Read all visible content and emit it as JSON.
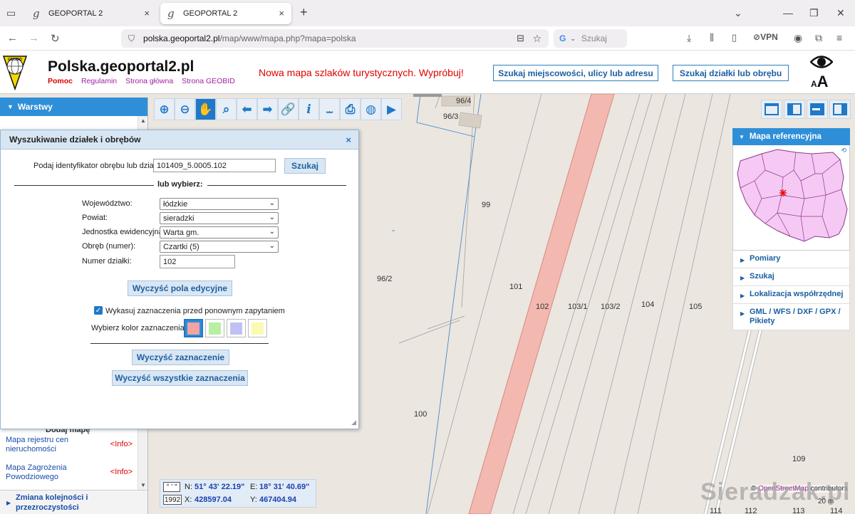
{
  "browser": {
    "tabs": [
      {
        "icon": "g",
        "title": "GEOPORTAL 2",
        "close": "×"
      },
      {
        "icon": "g",
        "title": "GEOPORTAL 2",
        "close": "×"
      }
    ],
    "new_tab": "+",
    "url_host": "polska.geoportal2.pl",
    "url_path": "/map/www/mapa.php?mapa=polska",
    "search_placeholder": "Szukaj",
    "vpn": "VPN"
  },
  "site": {
    "title": "Polska.geoportal2.pl",
    "logo_text": "GEOBID",
    "links": {
      "help": "Pomoc",
      "rules": "Regulamin",
      "home": "Strona główna",
      "geobid": "Strona GEOBID"
    },
    "promo": "Nowa mapa szlaków turystycznych. Wypróbuj!",
    "search_address_btn": "Szukaj miejscowości, ulicy lub adresu",
    "search_parcel_btn": "Szukaj działki lub obrębu",
    "font_small": "A",
    "font_big": "A"
  },
  "left_panel": {
    "header": "Warstwy",
    "add_map": "Dodaj mapę",
    "items": [
      {
        "label": "Mapa rejestru cen nieruchomości",
        "info": "<Info>"
      },
      {
        "label": "Mapa Zagrożenia Powodziowego",
        "info": "<Info>"
      }
    ],
    "bottom": "Zmiana kolejności i przezroczystości"
  },
  "dialog": {
    "title": "Wyszukiwanie działek i obrębów",
    "close": "×",
    "id_label": "Podaj identyfikator obrębu lub działki:",
    "id_value": "101409_5.0005.102",
    "search_btn": "Szukaj",
    "or_choose": "lub wybierz:",
    "fields": [
      {
        "label": "Województwo:",
        "value": "łódzkie"
      },
      {
        "label": "Powiat:",
        "value": "sieradzki"
      },
      {
        "label": "Jednostka ewidencyjna:",
        "value": "Warta gm."
      },
      {
        "label": "Obręb (numer):",
        "value": "Czartki (5)"
      }
    ],
    "parcel_label": "Numer działki:",
    "parcel_value": "102",
    "clear_fields_btn": "Wyczyść pola edycyjne",
    "checkbox_label": "Wykasuj zaznaczenia przed ponownym zapytaniem",
    "color_label": "Wybierz kolor zaznaczenia:",
    "colors": [
      "#f4a3a3",
      "#b6f0a0",
      "#c0c0f6",
      "#fafab0"
    ],
    "clear_selection_btn": "Wyczyść zaznaczenie",
    "clear_all_btn": "Wyczyść wszystkie zaznaczenia"
  },
  "right_panel": {
    "header": "Mapa referencyjna",
    "items": [
      "Pomiary",
      "Szukaj",
      "Lokalizacja współrzędnej",
      "GML / WFS / DXF / GPX / Pikiety"
    ]
  },
  "map": {
    "parcels": [
      "96/4",
      "96/3",
      "99",
      "96/2",
      "101",
      "102",
      "103/1",
      "103/2",
      "104",
      "105",
      "100",
      "109",
      "111",
      "112",
      "113",
      "114"
    ],
    "coords": {
      "format_btn": "° ' \"",
      "system_btn": "1992",
      "n_label": "N:",
      "n_value": "51° 43' 22.19\"",
      "e_label": "E:",
      "e_value": "18° 31' 40.69\"",
      "x_label": "X:",
      "x_value": "428597.04",
      "y_label": "Y:",
      "y_value": "467404.94"
    },
    "attribution_prefix": "© ",
    "attribution_osm": "OpenStreetMap",
    "attribution_suffix": " contributors",
    "scale": "20 m",
    "watermark": "Sieradzak.pl"
  }
}
